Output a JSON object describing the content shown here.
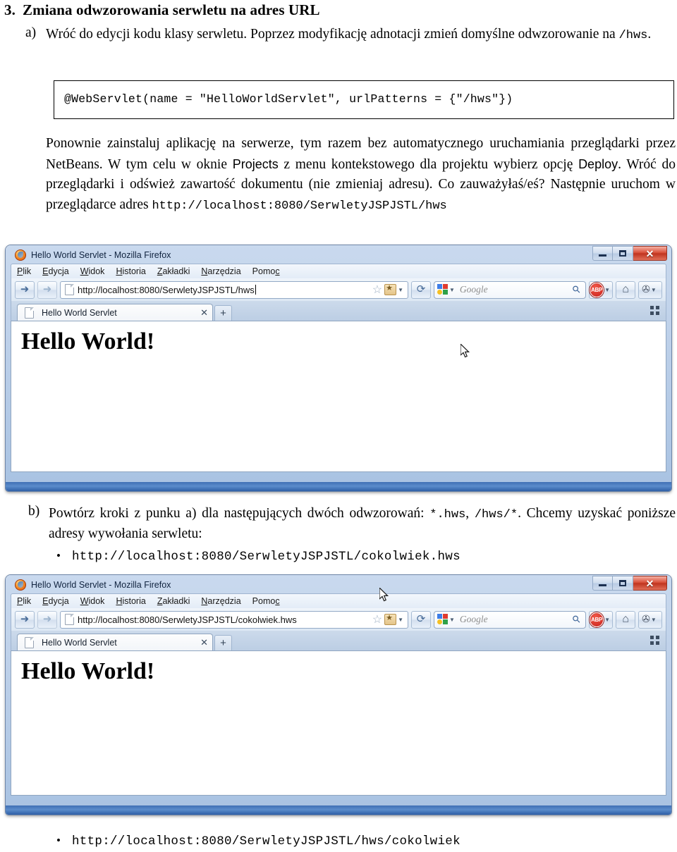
{
  "document": {
    "heading": {
      "number": "3.",
      "text": "Zmiana odwzorowania serwletu na adres URL"
    },
    "item_a": {
      "label": "a)",
      "text_1": "Wróć do edycji kodu klasy serwletu. Poprzez modyfikację adnotacji zmień domyślne odwzorowanie na ",
      "code_inline": "/hws",
      "text_2": ".",
      "code_block": "@WebServlet(name = \"HelloWorldServlet\", urlPatterns = {\"/hws\"})",
      "para_1": "Ponownie zainstaluj aplikację na serwerze, tym razem bez automatycznego uruchamiania przeglądarki przez NetBeans. W tym celu w oknie ",
      "emph_1": "Projects",
      "para_2": " z menu kontekstowego dla projektu wybierz opcję ",
      "emph_2": "Deploy",
      "para_3": ". Wróć do przeglądarki i odśwież zawartość dokumentu (nie zmieniaj adresu). Co zauważyłaś/eś? Następnie uruchom w przeglądarce adres ",
      "para_url": "http://localhost:8080/SerwletyJSPJSTL/hws"
    },
    "item_b": {
      "label": "b)",
      "text_1": "Powtórz kroki z punku a) dla następujących dwóch odwzorowań: ",
      "code_1": "*.hws",
      "text_2": ", ",
      "code_2": "/hws/*",
      "text_3": ".",
      "text_4": "Chcemy uzyskać poniższe adresy wywołania serwletu:"
    },
    "bullets": [
      {
        "marker": "•",
        "url": "http://localhost:8080/SerwletyJSPJSTL/cokolwiek.hws"
      },
      {
        "marker": "•",
        "url": "http://localhost:8080/SerwletyJSPJSTL/hws/cokolwiek"
      }
    ]
  },
  "browser_common": {
    "menu": [
      {
        "accel": "P",
        "rest": "lik"
      },
      {
        "accel": "E",
        "rest": "dycja"
      },
      {
        "accel": "W",
        "rest": "idok"
      },
      {
        "accel": "H",
        "rest": "istoria"
      },
      {
        "accel": "Z",
        "rest": "akładki"
      },
      {
        "accel": "N",
        "rest": "arzędzia"
      },
      {
        "accel": "Pomo",
        "rest": "c"
      }
    ],
    "menu_labels": [
      "Plik",
      "Edycja",
      "Widok",
      "Historia",
      "Zakładki",
      "Narzędzia",
      "Pomoc"
    ],
    "window_buttons": {
      "minimize": "minimize-icon",
      "restore": "restore-icon",
      "close": "✕"
    },
    "nav": {
      "back": "◄",
      "forward": "►",
      "reload": "⟳"
    },
    "search": {
      "engine": "google-icon",
      "placeholder": "Google",
      "magnifier": "search-icon"
    },
    "toolbar_icons": {
      "adblock": "ABP",
      "home": "⌂",
      "tools": "tools-icon",
      "dropdown": "▾"
    },
    "tab": {
      "title": "Hello World Servlet",
      "close": "✕",
      "newtab": "+",
      "listall": "list-all-tabs-icon"
    },
    "page_heading": "Hello World!",
    "star": "☆",
    "bookmark": "bookmark-icon"
  },
  "browser_1": {
    "title": "Hello World Servlet - Mozilla Firefox",
    "url": "http://localhost:8080/SerwletyJSPJSTL/hws",
    "cursor_in_content": true
  },
  "browser_2": {
    "title": "Hello World Servlet - Mozilla Firefox",
    "url": "http://localhost:8080/SerwletyJSPJSTL/cokolwiek.hws",
    "cursor_on_bookmark": true
  },
  "colors": {
    "aero_frame": "#a8c2e2",
    "aero_bottom": "#3f6fb5",
    "close_red": "#c0341f",
    "content_bg": "#ffffff",
    "text": "#000000"
  }
}
